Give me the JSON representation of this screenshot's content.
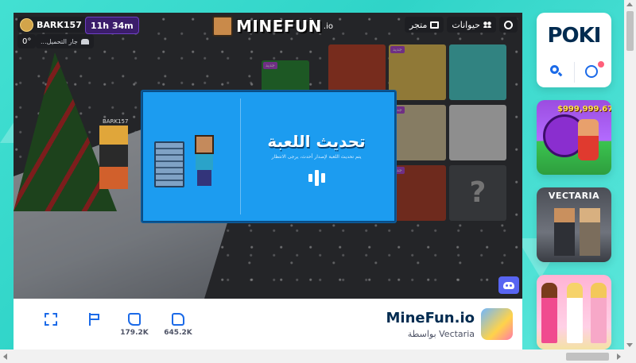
{
  "game": {
    "hud": {
      "username": "BARK157",
      "playtime": "11h 34m",
      "rotation": "0°",
      "loading_text": "...جار التحميل"
    },
    "logo": {
      "name": "MINEFUN",
      "suffix": ".io"
    },
    "top_buttons": {
      "pets": "حيوانات",
      "shop": "متجر"
    },
    "nametag": "BARK157",
    "update_dialog": {
      "title": "تحديث اللعبة",
      "subtitle": "يتم تحديث اللعبة لإصدار أحدث، يرجى الانتظار"
    },
    "thumb_tags": [
      "جديد",
      "جديد",
      "جديد",
      "جديد"
    ]
  },
  "bottom_bar": {
    "game_title": "MineFun.io",
    "developer": "بواسطة Vectaria",
    "dislikes": "179.2K",
    "likes": "645.2K"
  },
  "sidebar": {
    "logo": "POKI",
    "tiles": [
      {
        "label": "$999,999.67"
      },
      {
        "label": "VECTARIA"
      }
    ]
  },
  "colors": {
    "poki_blue": "#1b6ae8",
    "poki_navy": "#002b50",
    "modal_blue": "#1c9cf0",
    "background_teal": "#43e0d2",
    "discord": "#5865f2"
  }
}
